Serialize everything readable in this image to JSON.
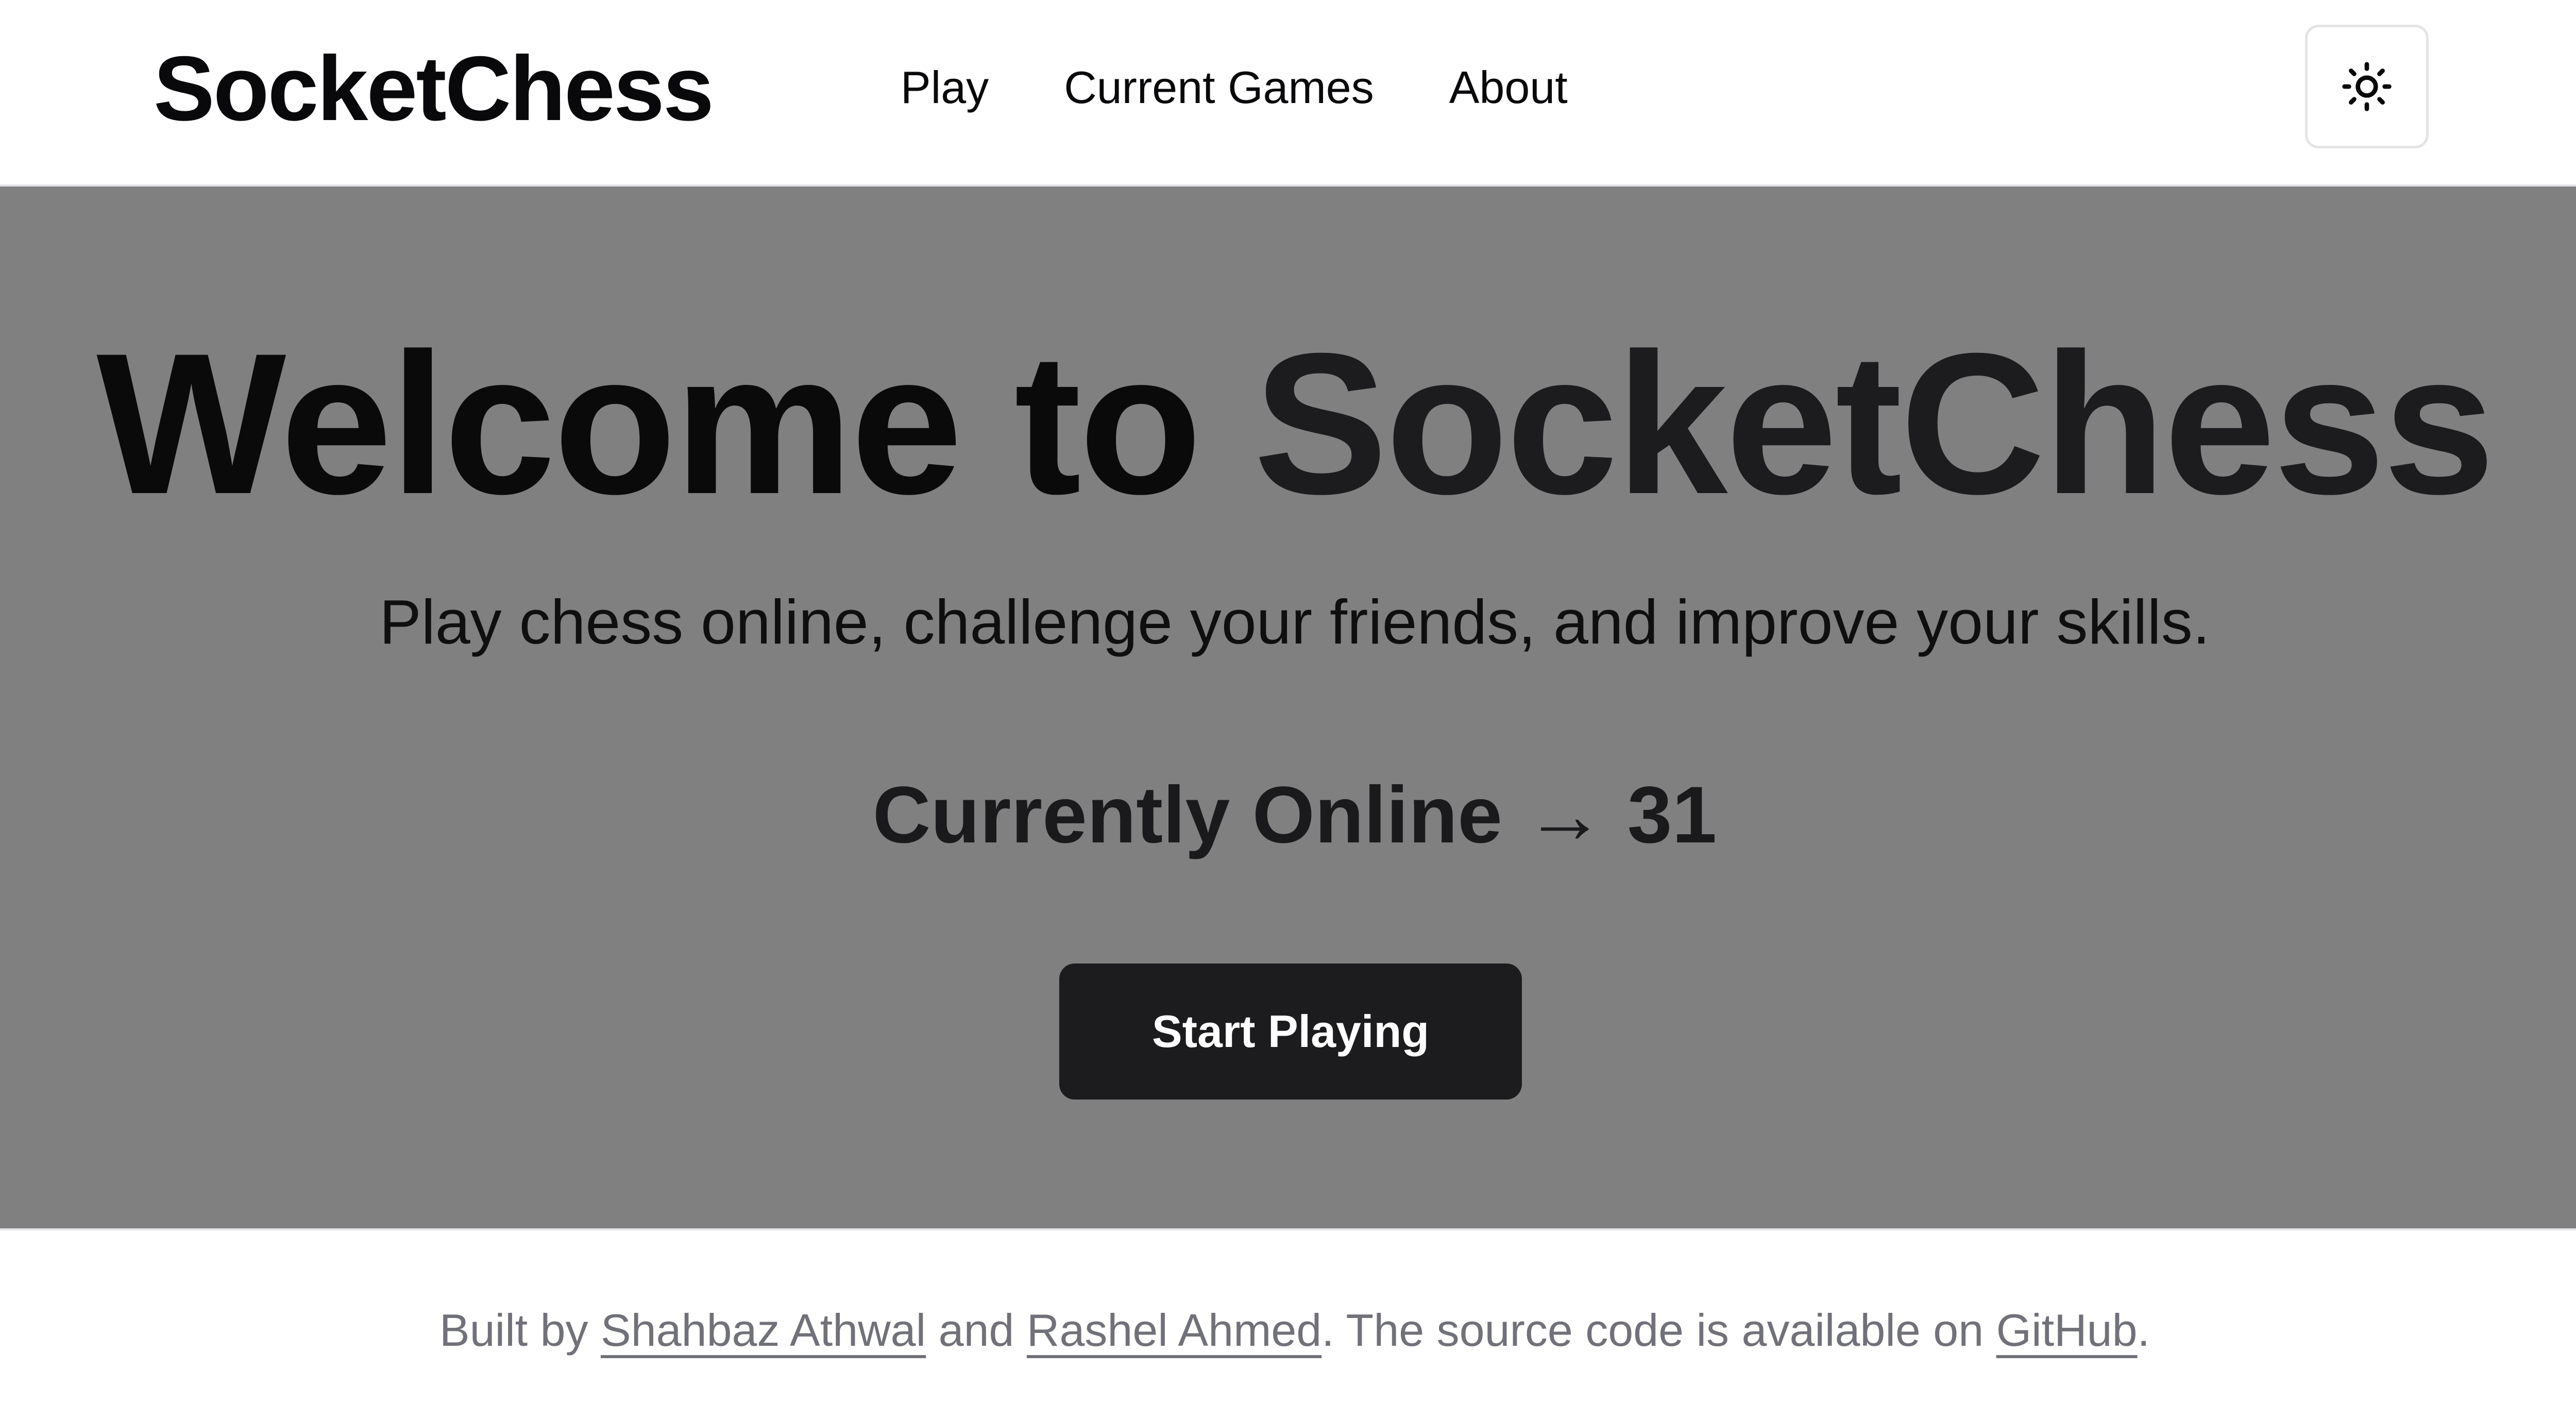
{
  "header": {
    "brand": "SocketChess",
    "nav": [
      {
        "label": "Play"
      },
      {
        "label": "Current Games"
      },
      {
        "label": "About"
      }
    ],
    "theme_toggle_icon": "sun-icon"
  },
  "hero": {
    "title_prefix": "Welcome to",
    "title_brand": "SocketChess",
    "subtitle": "Play chess online, challenge your friends, and improve your skills.",
    "online_label": "Currently Online",
    "online_arrow": "→",
    "online_count": "31",
    "cta_label": "Start Playing",
    "background_color": "#808080",
    "cta_color": "#1c1c1e"
  },
  "footer": {
    "text_built_by": "Built by",
    "author1": "Shahbaz Athwal",
    "text_and": "and",
    "author2": "Rashel Ahmed",
    "text_source": ". The source code is available on",
    "github": "GitHub",
    "text_end": "."
  }
}
